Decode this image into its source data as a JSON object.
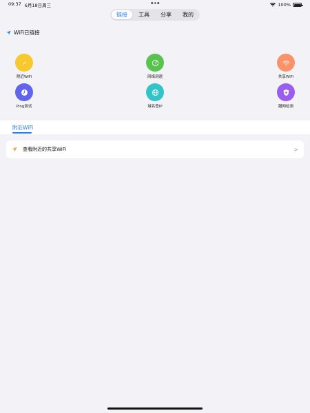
{
  "status_bar": {
    "time": "09:37",
    "date": "6月18日周三",
    "battery": "100%",
    "battery_level": 1.0
  },
  "segmented": {
    "tabs": [
      {
        "label": "链接",
        "active": true
      },
      {
        "label": "工具",
        "active": false
      },
      {
        "label": "分享",
        "active": false
      },
      {
        "label": "我的",
        "active": false
      }
    ]
  },
  "wifi_status": {
    "label": "WiFi已链接",
    "icon": "location-arrow-icon"
  },
  "tools": [
    {
      "label": "附近WiFi",
      "color": "#f8c92f",
      "icon": "compass-icon"
    },
    {
      "label": "网络测速",
      "color": "#58c44e",
      "icon": "speedometer-icon"
    },
    {
      "label": "共享WiFi",
      "color": "#f8936a",
      "icon": "wifi-icon"
    },
    {
      "label": "Ping测试",
      "color": "#6265ec",
      "icon": "clock-icon"
    },
    {
      "label": "域名查IP",
      "color": "#33c4c9",
      "icon": "globe-icon"
    },
    {
      "label": "蹭网检测",
      "color": "#9b5cf0",
      "icon": "shield-icon"
    }
  ],
  "section_tab": {
    "label": "附近WiFi"
  },
  "card": {
    "label": "查看附近的共享WiFi",
    "chevron": ">",
    "icon": "location-arrow-icon",
    "icon_color": "#f2a33a"
  },
  "colors": {
    "accent": "#2a7ae2",
    "background": "#f2f2f7"
  }
}
